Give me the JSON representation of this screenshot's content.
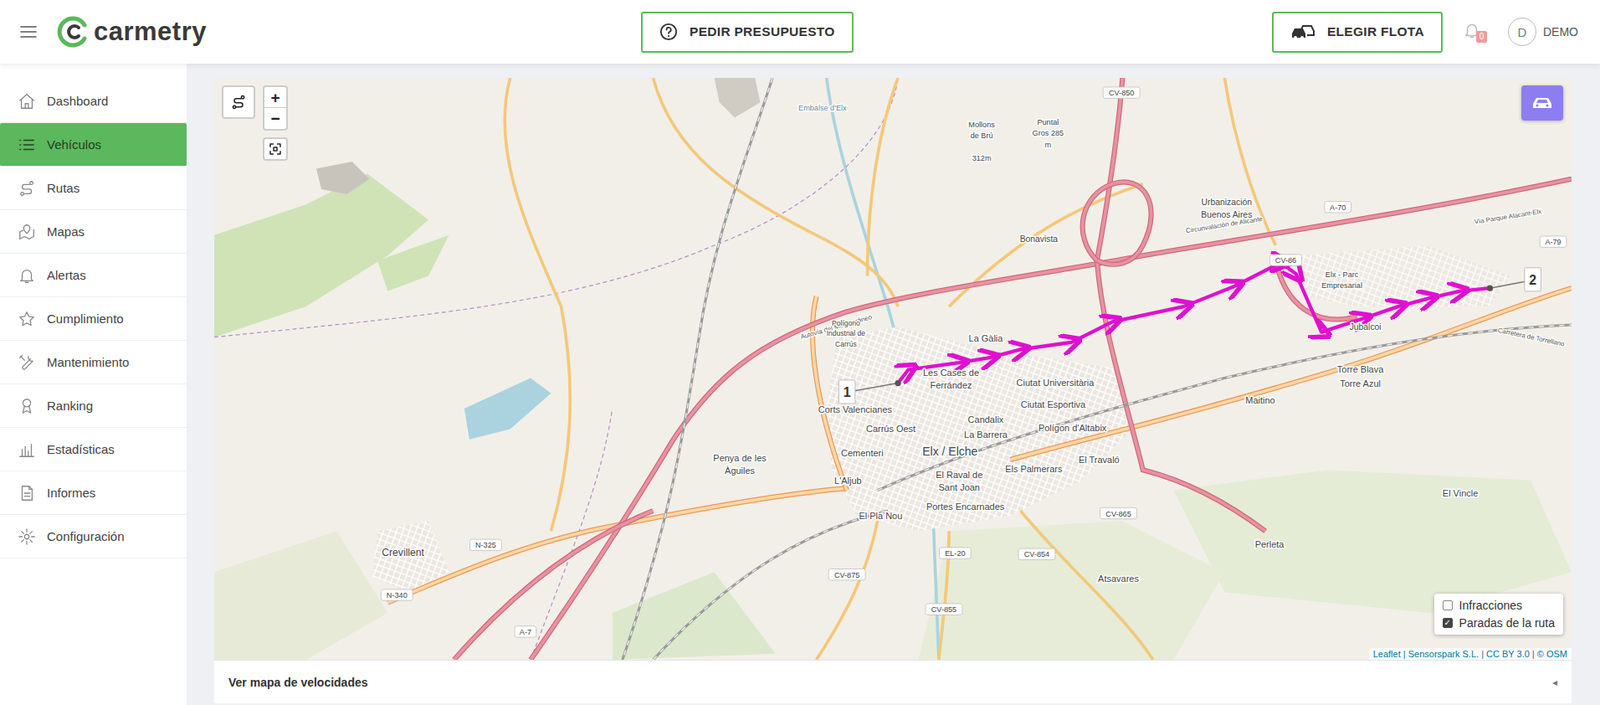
{
  "app": {
    "logo": "carmetry"
  },
  "header": {
    "quote_button": "PEDIR PRESUPUESTO",
    "fleet_button": "ELEGIR FLOTA",
    "notifications": "0",
    "avatar": "D",
    "user": "DEMO"
  },
  "sidebar": {
    "items": [
      {
        "label": "Dashboard",
        "selected": false
      },
      {
        "label": "Vehículos",
        "selected": true
      },
      {
        "label": "Rutas",
        "selected": false
      },
      {
        "label": "Mapas",
        "selected": false
      },
      {
        "label": "Alertas",
        "selected": false
      },
      {
        "label": "Cumplimiento",
        "selected": false
      },
      {
        "label": "Mantenimiento",
        "selected": false
      },
      {
        "label": "Ranking",
        "selected": false
      },
      {
        "label": "Estadísticas",
        "selected": false
      },
      {
        "label": "Informes",
        "selected": false
      },
      {
        "label": "Configuración",
        "selected": false
      }
    ]
  },
  "map": {
    "zoom_in": "+",
    "zoom_out": "−",
    "labels": [
      "Embalse d'Elx",
      "Puntal",
      "Gros 285",
      "m",
      "Mollons",
      "de Brú",
      "312m",
      "Urbanización",
      "Buenos Aires",
      "Bonavista",
      "Elx - Parc",
      "Empresarial",
      "Jubalcoi",
      "La Gàlia",
      "Les Cases de",
      "Ferrández",
      "Ciutat Universitària",
      "Polígono",
      "Industrial de",
      "Carrús",
      "Corts Valencianes",
      "Carrús Oest",
      "Candalix",
      "La Barrera",
      "Ciutat Esportiva",
      "Polígon d'Altabix",
      "Elx / Elche",
      "Cementeri",
      "Penya de les",
      "Àguiles",
      "El Raval de",
      "Sant Joan",
      "Els Palmerars",
      "El Travaló",
      "L'Aljub",
      "Portes Encarnades",
      "El Pla Nou",
      "Torre Blava",
      "Torre Azul",
      "Maitino",
      "El Vincle",
      "Perleta",
      "Atsavares",
      "Crevillent"
    ],
    "road_labels": [
      "Autovía del Mediterráneo",
      "Circunvalación de Alicante",
      "Vía Parque Alacant-Elx",
      "Carretera de Torrellano"
    ],
    "shields": [
      "CV-850",
      "A-70",
      "A-79",
      "CV-86",
      "N-325",
      "N-340",
      "A-7",
      "CV-875",
      "CV-855",
      "CV-854",
      "CV-865",
      "EL-20"
    ],
    "stops": [
      "1",
      "2"
    ],
    "layers": [
      {
        "label": "Infracciones",
        "checked": false
      },
      {
        "label": "Paradas de la ruta",
        "checked": true
      }
    ],
    "attribution": "Leaflet | Sensorspark S.L. | CC BY 3.0 | © OSM"
  },
  "speed_map": {
    "label": "Ver mapa de velocidades",
    "toggle": "◂"
  }
}
